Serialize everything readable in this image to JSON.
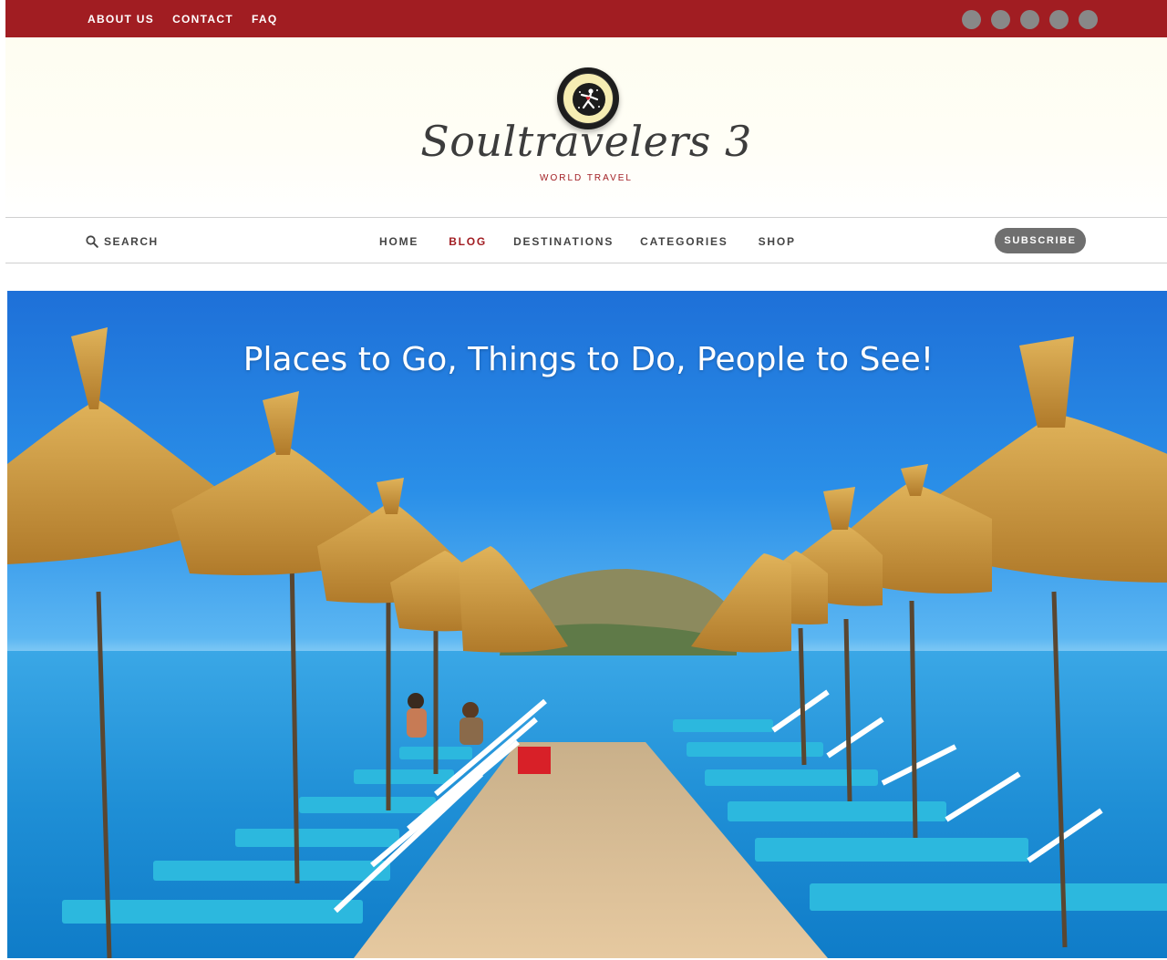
{
  "topbar": {
    "links": [
      "ABOUT US",
      "CONTACT",
      "FAQ"
    ],
    "social_icons": [
      "facebook-icon",
      "twitter-icon",
      "instagram-icon",
      "pinterest-icon",
      "youtube-icon"
    ],
    "bg_color": "#a11d22"
  },
  "header": {
    "brand": "Soultravelers 3",
    "tagline": "WORLD TRAVEL"
  },
  "nav": {
    "search_label": "SEARCH",
    "items": [
      "HOME",
      "BLOG",
      "DESTINATIONS",
      "CATEGORIES",
      "SHOP"
    ],
    "active": "BLOG",
    "subscribe_label": "SUBSCRIBE"
  },
  "hero": {
    "title": "Places to Go, Things to Do, People to See!"
  },
  "colors": {
    "accent": "#a11d22",
    "subscribe_bg": "#6f6f6f"
  }
}
